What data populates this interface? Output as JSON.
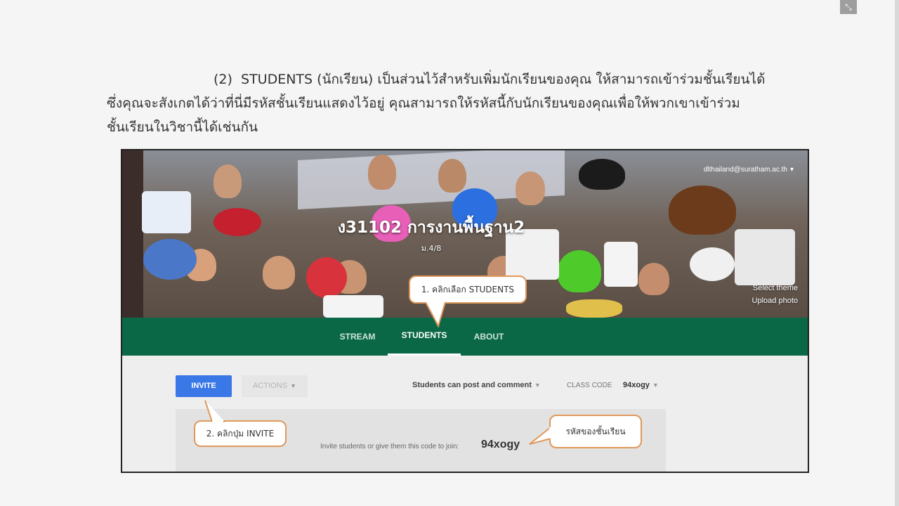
{
  "slide": {
    "paragraph_number": "(2)",
    "paragraph_line1": "STUDENTS (นักเรียน) เป็นส่วนไว้สำหรับเพิ่มนักเรียนของคุณ ให้สามารถเข้าร่วมชั้นเรียนได้",
    "paragraph_line2": "ซึ่งคุณจะสังเกตได้ว่าที่นี่มีรหัสชั้นเรียนแสดงไว้อยู่  คุณสามารถให้รหัสนี้กับนักเรียนของคุณเพื่อให้พวกเขาเข้าร่วม",
    "paragraph_line3": "ชั้นเรียนในวิชานี้ได้เช่นกัน",
    "fullscreen_icon": "collapse-arrows-icon"
  },
  "classroom": {
    "class_title": "ง31102 การงานพื้นฐาน2",
    "class_section": "ม.4/8",
    "account_email": "dlthailand@suratham.ac.th",
    "select_theme": "Select theme",
    "upload_photo": "Upload photo",
    "tabs": [
      {
        "label": "STREAM",
        "active": false
      },
      {
        "label": "STUDENTS",
        "active": true
      },
      {
        "label": "ABOUT",
        "active": false
      }
    ],
    "invite_label": "INVITE",
    "actions_label": "ACTIONS",
    "permission_label": "Students can post and comment",
    "class_code_label": "CLASS CODE",
    "class_code_value": "94xogy",
    "invite_text": "Invite students or give them this code to join:",
    "invite_code": "94xogy"
  },
  "callouts": {
    "step1": "1. คลิกเลือก STUDENTS",
    "step2": "2. คลิกปุ่ม INVITE",
    "code_note": "รหัสของชั้นเรียน"
  },
  "colors": {
    "tab_bar": "#0a6847",
    "invite_button": "#3b78e7",
    "callout_border": "#e0985a"
  }
}
